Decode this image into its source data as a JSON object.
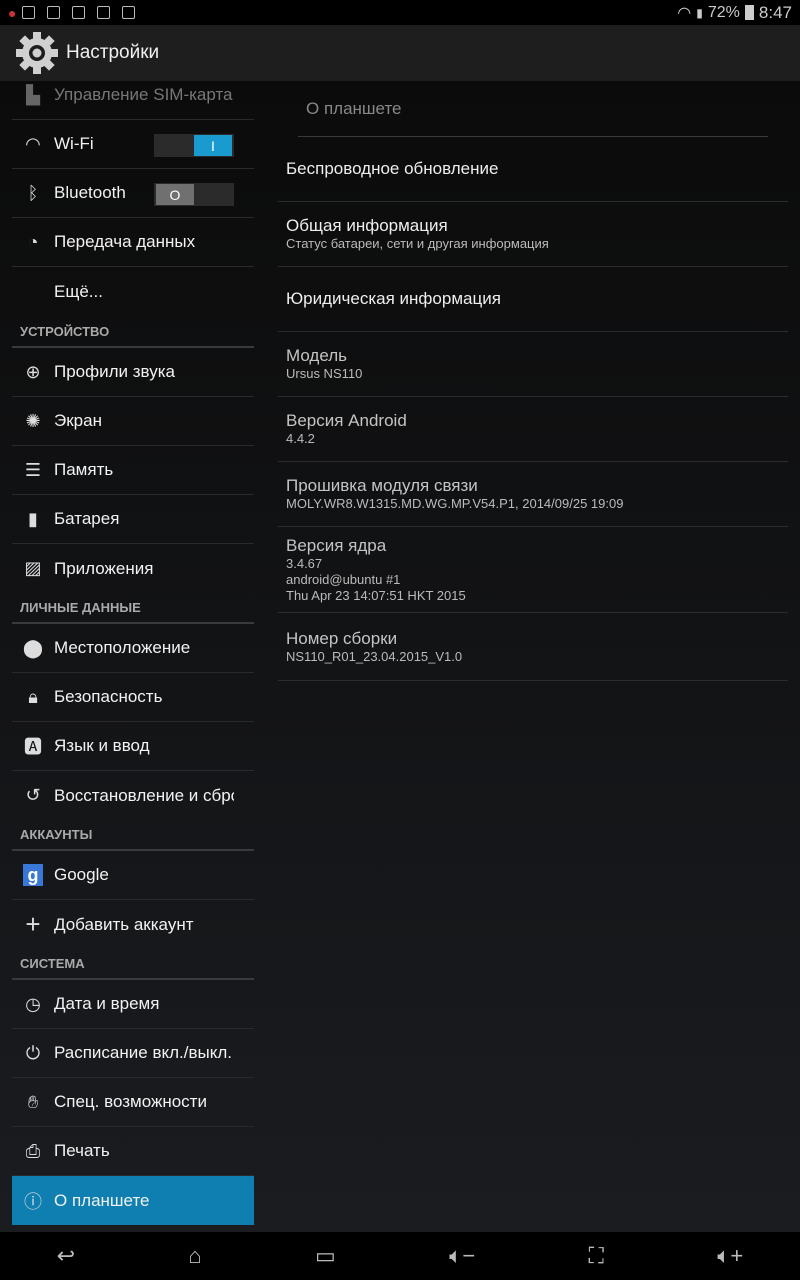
{
  "status_bar": {
    "battery": "72%",
    "time": "8:47",
    "notification_icons": [
      "app-icon",
      "image-icon",
      "download-icon",
      "gmail-icon",
      "task-icon",
      "store-icon"
    ]
  },
  "action_bar": {
    "title": "Настройки",
    "icon": "settings-gear-icon"
  },
  "sidebar": {
    "top_partial": {
      "label": "Управление SIM-карта",
      "icon": "sim-icon"
    },
    "wireless": [
      {
        "label": "Wi-Fi",
        "icon": "wifi-icon",
        "toggle": "on"
      },
      {
        "label": "Bluetooth",
        "icon": "bluetooth-icon",
        "toggle": "off"
      },
      {
        "label": "Передача данных",
        "icon": "data-usage-icon"
      },
      {
        "label": "Ещё...",
        "icon": ""
      }
    ],
    "device_header": "УСТРОЙСТВО",
    "device": [
      {
        "label": "Профили звука",
        "icon": "sound-icon"
      },
      {
        "label": "Экран",
        "icon": "display-icon"
      },
      {
        "label": "Память",
        "icon": "storage-icon"
      },
      {
        "label": "Батарея",
        "icon": "battery-icon"
      },
      {
        "label": "Приложения",
        "icon": "apps-icon"
      }
    ],
    "personal_header": "ЛИЧНЫЕ ДАННЫЕ",
    "personal": [
      {
        "label": "Местоположение",
        "icon": "location-icon"
      },
      {
        "label": "Безопасность",
        "icon": "lock-icon"
      },
      {
        "label": "Язык и ввод",
        "icon": "language-icon"
      },
      {
        "label": "Восстановление и сброс",
        "icon": "backup-icon"
      }
    ],
    "accounts_header": "АККАУНТЫ",
    "accounts": [
      {
        "label": "Google",
        "icon": "google-icon"
      },
      {
        "label": "Добавить аккаунт",
        "icon": "plus-icon"
      }
    ],
    "system_header": "СИСТЕМА",
    "system": [
      {
        "label": "Дата и время",
        "icon": "clock-icon"
      },
      {
        "label": "Расписание вкл./выкл.",
        "icon": "power-schedule-icon"
      },
      {
        "label": "Спец. возможности",
        "icon": "accessibility-icon"
      },
      {
        "label": "Печать",
        "icon": "print-icon"
      },
      {
        "label": "О планшете",
        "icon": "info-icon",
        "selected": true
      }
    ]
  },
  "pane": {
    "title": "О планшете",
    "items": [
      {
        "title": "Беспроводное обновление"
      },
      {
        "title": "Общая информация",
        "summary": "Статус батареи, сети и другая информация"
      },
      {
        "title": "Юридическая информация"
      },
      {
        "title": "Модель",
        "summary": "Ursus NS110"
      },
      {
        "title": "Версия Android",
        "summary": "4.4.2"
      },
      {
        "title": "Прошивка модуля связи",
        "summary": "MOLY.WR8.W1315.MD.WG.MP.V54.P1, 2014/09/25 19:09"
      },
      {
        "title": "Версия ядра",
        "summary": "3.4.67",
        "summary2": "android@ubuntu #1",
        "summary3": "Thu Apr 23 14:07:51 HKT 2015"
      },
      {
        "title": "Номер сборки",
        "summary": "NS110_R01_23.04.2015_V1.0"
      }
    ]
  },
  "nav_bar": [
    "back-icon",
    "home-icon",
    "recents-icon",
    "volume-down-icon",
    "screenshot-icon",
    "volume-up-icon"
  ],
  "colors": {
    "accent": "#0e7fb0",
    "toggle_on": "#1a9bd0",
    "background": "#000000"
  }
}
